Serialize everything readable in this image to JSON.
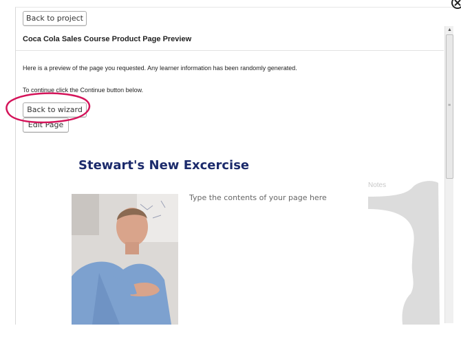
{
  "toolbar": {
    "back_to_project": "Back to project"
  },
  "panel": {
    "title": "Coca Cola Sales Course Product Page Preview",
    "intro": "Here is a preview of the page you requested. Any learner information has been randomly generated.",
    "continue_text": "To continue click the Continue button below.",
    "back_to_wizard": "Back to wizard",
    "edit_page": "Edit Page"
  },
  "preview": {
    "heading": "Stewart's New Excercise",
    "content_placeholder": "Type the contents of your page here",
    "notes_label": "Notes"
  },
  "colors": {
    "heading": "#1b2a6b",
    "highlight": "#d4145a",
    "notes": "#dcdcdc"
  }
}
